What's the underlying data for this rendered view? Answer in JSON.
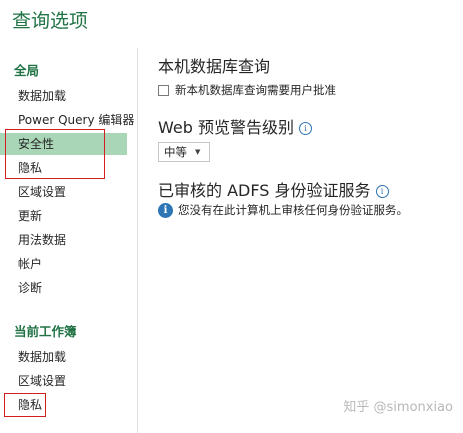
{
  "window": {
    "title": "查询选项"
  },
  "sidebar": {
    "global": {
      "heading": "全局",
      "items": [
        {
          "label": "数据加载",
          "selected": false
        },
        {
          "label": "Power Query 编辑器",
          "selected": false
        },
        {
          "label": "安全性",
          "selected": true
        },
        {
          "label": "隐私",
          "selected": false
        },
        {
          "label": "区域设置",
          "selected": false
        },
        {
          "label": "更新",
          "selected": false
        },
        {
          "label": "用法数据",
          "selected": false
        },
        {
          "label": "帐户",
          "selected": false
        },
        {
          "label": "诊断",
          "selected": false
        }
      ]
    },
    "workbook": {
      "heading": "当前工作簿",
      "items": [
        {
          "label": "数据加载",
          "selected": false
        },
        {
          "label": "区域设置",
          "selected": false
        },
        {
          "label": "隐私",
          "selected": false
        }
      ]
    }
  },
  "main": {
    "native_query": {
      "heading": "本机数据库查询",
      "checkbox_label": "新本机数据库查询需要用户批准",
      "checked": false
    },
    "web_preview": {
      "heading": "Web 预览警告级别",
      "dropdown_value": "中等"
    },
    "adfs": {
      "heading": "已审核的 ADFS 身份验证服务",
      "notice": "您没有在此计算机上审核任何身份验证服务。"
    }
  },
  "watermark": "知乎 @simonxiao",
  "colors": {
    "accent": "#217346",
    "selected_bg": "#a9d6b6",
    "highlight_box": "#d11f1f",
    "info": "#2e75b6"
  }
}
